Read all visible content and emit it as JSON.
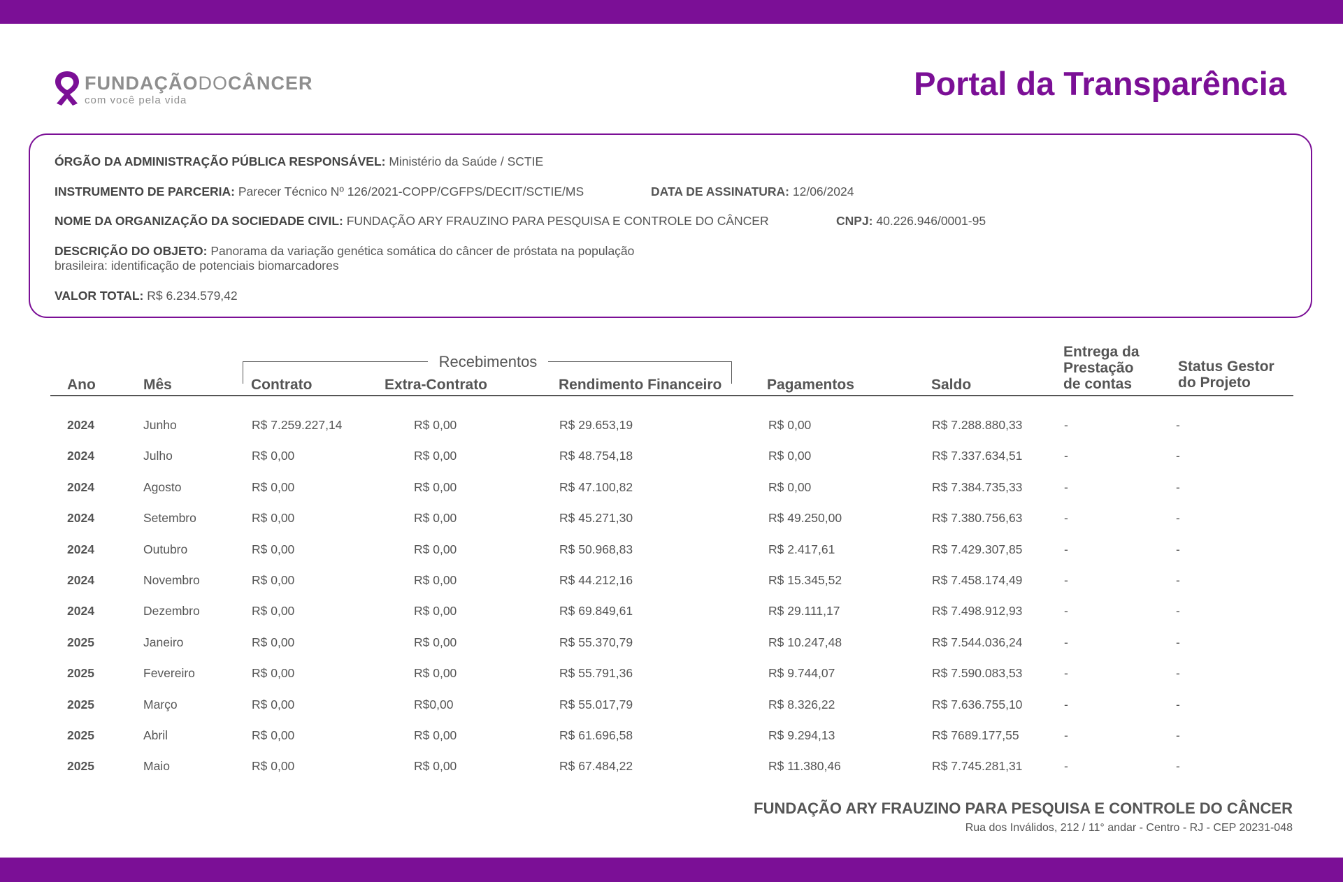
{
  "colors": {
    "accent": "#7b0f96",
    "text": "#444444"
  },
  "logo": {
    "icon": "ribbon-icon",
    "name_bold": "FUNDAÇÃO",
    "name_thin": "DO",
    "name_end": "CÂNCER",
    "tagline": "com você  pela vida"
  },
  "header": {
    "title": "Portal da Transparência"
  },
  "info": {
    "orgao": {
      "label": "ÓRGÃO DA ADMINISTRAÇÃO PÚBLICA RESPONSÁVEL:",
      "value": " Ministério da Saúde / SCTIE"
    },
    "instrumento": {
      "label": "INSTRUMENTO DE PARCERIA:",
      "value": " Parecer Técnico  Nº 126/2021-COPP/CGFPS/DECIT/SCTIE/MS"
    },
    "data_assinatura": {
      "label": "DATA DE ASSINATURA:",
      "value": " 12/06/2024"
    },
    "nome_org": {
      "label": "NOME DA ORGANIZAÇÃO DA SOCIEDADE CIVIL:",
      "value": " FUNDAÇÃO ARY FRAUZINO PARA PESQUISA E CONTROLE DO CÂNCER"
    },
    "cnpj": {
      "label": "CNPJ:",
      "value": " 40.226.946/0001-95"
    },
    "descricao": {
      "label": "DESCRIÇÃO DO OBJETO:",
      "value_line1": " Panorama da variação genética somática do câncer de próstata na população",
      "value_line2": "brasileira: identificação de potenciais biomarcadores"
    },
    "valor_total": {
      "label": "VALOR TOTAL:",
      "value": " R$ 6.234.579,42"
    }
  },
  "table": {
    "group_label": "Recebimentos",
    "headers": {
      "ano": "Ano",
      "mes": "Mês",
      "contrato": "Contrato",
      "extra": "Extra-Contrato",
      "rendimento": "Rendimento Financeiro",
      "pagamentos": "Pagamentos",
      "saldo": "Saldo",
      "entrega_1": "Entrega da",
      "entrega_2": "Prestação",
      "entrega_3": "de contas",
      "status_1": "Status Gestor",
      "status_2": "do Projeto"
    },
    "rows": [
      [
        "2024",
        "Junho",
        "R$ 7.259.227,14",
        "R$ 0,00",
        "R$ 29.653,19",
        "R$ 0,00",
        "R$ 7.288.880,33",
        "-",
        "-"
      ],
      [
        "2024",
        "Julho",
        "R$ 0,00",
        "R$ 0,00",
        "R$ 48.754,18",
        "R$ 0,00",
        "R$ 7.337.634,51",
        "-",
        "-"
      ],
      [
        "2024",
        "Agosto",
        "R$ 0,00",
        "R$ 0,00",
        "R$ 47.100,82",
        "R$ 0,00",
        "R$ 7.384.735,33",
        "-",
        "-"
      ],
      [
        "2024",
        "Setembro",
        "R$ 0,00",
        "R$ 0,00",
        "R$ 45.271,30",
        "R$ 49.250,00",
        "R$ 7.380.756,63",
        "-",
        "-"
      ],
      [
        "2024",
        "Outubro",
        "R$ 0,00",
        "R$ 0,00",
        "R$ 50.968,83",
        "R$ 2.417,61",
        "R$ 7.429.307,85",
        "-",
        "-"
      ],
      [
        "2024",
        "Novembro",
        "R$ 0,00",
        "R$ 0,00",
        "R$ 44.212,16",
        "R$ 15.345,52",
        "R$ 7.458.174,49",
        "-",
        "-"
      ],
      [
        "2024",
        "Dezembro",
        "R$ 0,00",
        "R$ 0,00",
        "R$ 69.849,61",
        "R$ 29.111,17",
        "R$ 7.498.912,93",
        "-",
        "-"
      ],
      [
        "2025",
        "Janeiro",
        "R$ 0,00",
        "R$ 0,00",
        "R$ 55.370,79",
        "R$ 10.247,48",
        "R$ 7.544.036,24",
        "-",
        "-"
      ],
      [
        "2025",
        "Fevereiro",
        "R$ 0,00",
        "R$ 0,00",
        "R$ 55.791,36",
        "R$ 9.744,07",
        "R$ 7.590.083,53",
        "-",
        "-"
      ],
      [
        "2025",
        "Março",
        "R$ 0,00",
        "R$0,00",
        "R$ 55.017,79",
        "R$ 8.326,22",
        "R$ 7.636.755,10",
        "-",
        "-"
      ],
      [
        "2025",
        "Abril",
        "R$ 0,00",
        "R$ 0,00",
        "R$ 61.696,58",
        "R$ 9.294,13",
        "R$ 7689.177,55",
        "-",
        "-"
      ],
      [
        "2025",
        "Maio",
        "R$ 0,00",
        "R$ 0,00",
        "R$ 67.484,22",
        "R$ 11.380,46",
        "R$ 7.745.281,31",
        "-",
        "-"
      ]
    ]
  },
  "footer": {
    "org": "FUNDAÇÃO ARY FRAUZINO PARA PESQUISA E CONTROLE DO CÂNCER",
    "address": "Rua dos Inválidos, 212 / 11° andar - Centro - RJ - CEP 20231-048"
  }
}
